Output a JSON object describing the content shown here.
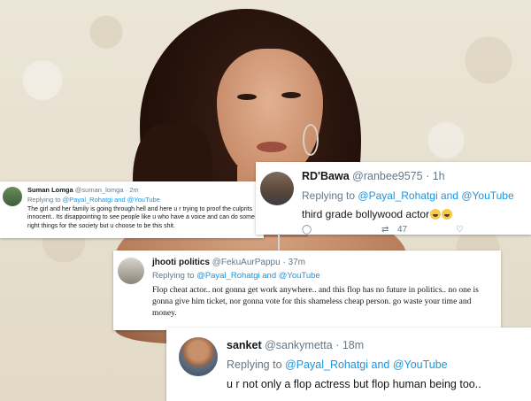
{
  "colors": {
    "link": "#1b95e0",
    "muted_text": "#657786",
    "primary_text": "#14171a",
    "card_background": "#ffffff"
  },
  "tweets": [
    {
      "name": "Suman Lomga",
      "handle": "@suman_lomga",
      "separator": "·",
      "time": "2m",
      "replying_prefix": "Replying to",
      "mention": "@Payal_Rohatgi and @YouTube",
      "body": "The girl and her family is going through hell and here u r trying to proof the culprits innocent.. Its disappointing to see people like u who have a voice and can do some right things for the society but u choose to be this shit.",
      "avatar_icon": "user-avatar-icon"
    },
    {
      "name": "RD'Bawa",
      "handle": "@ranbee9575",
      "separator": "·",
      "time": "1h",
      "replying_prefix": "Replying to",
      "mention": "@Payal_Rohatgi and @YouTube",
      "body": "third grade bollywood actor",
      "emoji_icons": [
        "laughing-tears-emoji-icon",
        "laughing-tears-emoji-icon"
      ],
      "actions": {
        "retweet_count": "47"
      },
      "avatar_icon": "user-avatar-icon"
    },
    {
      "name": "jhooti politics",
      "handle": "@FekuAurPappu",
      "separator": "·",
      "time": "37m",
      "replying_prefix": "Replying to",
      "mention": "@Payal_Rohatgi and @YouTube",
      "body": "Flop cheat actor.. not gonna get work anywhere.. and this flop has no future in politics.. no one is gonna give him ticket, nor gonna vote for this shameless cheap person. go waste your time and money.",
      "avatar_icon": "user-avatar-icon"
    },
    {
      "name": "sanket",
      "handle": "@sankymetta",
      "separator": "·",
      "time": "18m",
      "replying_prefix": "Replying to",
      "mention": "@Payal_Rohatgi and @YouTube",
      "body": "u r not only a flop actress but flop human being too..",
      "avatar_icon": "user-avatar-icon"
    }
  ]
}
